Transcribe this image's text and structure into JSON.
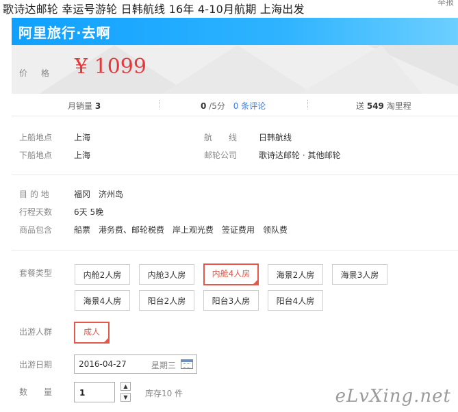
{
  "header": {
    "title": "歌诗达邮轮 幸运号游轮 日韩航线 16年 4-10月航期 上海出发",
    "report_link": "举报"
  },
  "banner": {
    "logo_text": "阿里旅行·去啊"
  },
  "price": {
    "label": "价格",
    "value": "¥ 1099"
  },
  "stats": {
    "monthly_sales_label": "月销量",
    "monthly_sales_value": "3",
    "rating_value": "0",
    "rating_suffix": "/5分",
    "reviews_link": "0 条评论",
    "points_prefix": "送",
    "points_value": "549",
    "points_suffix": "淘里程"
  },
  "info": {
    "board_label": "上船地点",
    "board_value": "上海",
    "route_label": "航　　线",
    "route_value": "日韩航线",
    "alight_label": "下船地点",
    "alight_value": "上海",
    "company_label": "邮轮公司",
    "company_value": "歌诗达邮轮 · 其他邮轮",
    "dest_label": "目 的 地",
    "dest_value": "福冈　济州岛",
    "days_label": "行程天数",
    "days_value": "6天 5晚",
    "includes_label": "商品包含",
    "includes_value": "船票　港务费、邮轮税费　岸上观光费　签证费用　领队费"
  },
  "package": {
    "label": "套餐类型",
    "options": [
      "内舱2人房",
      "内舱3人房",
      "内舱4人房",
      "海景2人房",
      "海景3人房",
      "海景4人房",
      "阳台2人房",
      "阳台3人房",
      "阳台4人房"
    ],
    "selected": "内舱4人房"
  },
  "group": {
    "label": "出游人群",
    "option": "成人"
  },
  "date": {
    "label": "出游日期",
    "value": "2016-04-27",
    "weekday": "星期三"
  },
  "quantity": {
    "label": "数　　量",
    "value": "1",
    "stock": "库存10 件"
  },
  "watermark": "eLvXing.net",
  "colors": {
    "accent": "#e4574a",
    "price": "#e4393c",
    "banner": "#1aa6ff",
    "link": "#3a7bd5"
  }
}
